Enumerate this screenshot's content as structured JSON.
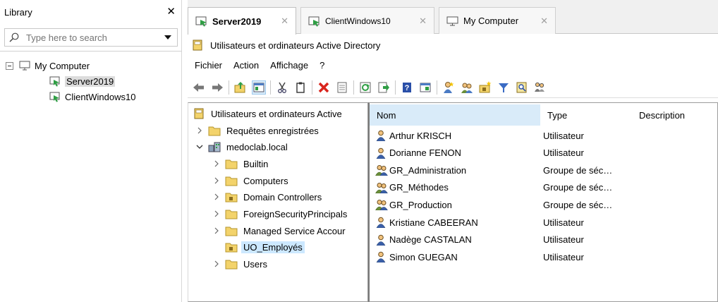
{
  "library": {
    "title": "Library",
    "close": "✕",
    "search_placeholder": "Type here to search",
    "root": "My Computer",
    "items": [
      "Server2019",
      "ClientWindows10"
    ]
  },
  "tabs": [
    {
      "label": "Server2019",
      "close": "✕"
    },
    {
      "label": "ClientWindows10",
      "close": "✕"
    },
    {
      "label": "My Computer",
      "close": "✕"
    }
  ],
  "app": {
    "title": "Utilisateurs et ordinateurs Active Directory",
    "menu": [
      "Fichier",
      "Action",
      "Affichage",
      "?"
    ]
  },
  "tree": {
    "root": "Utilisateurs et ordinateurs Active",
    "saved_queries": "Requêtes enregistrées",
    "domain": "medoclab.local",
    "children": [
      "Builtin",
      "Computers",
      "Domain Controllers",
      "ForeignSecurityPrincipals",
      "Managed Service Accour",
      "UO_Employés",
      "Users"
    ]
  },
  "list": {
    "columns": [
      "Nom",
      "Type",
      "Description"
    ],
    "rows": [
      {
        "name": "Arthur KRISCH",
        "type": "Utilisateur",
        "icon": "user-icon"
      },
      {
        "name": "Dorianne FENON",
        "type": "Utilisateur",
        "icon": "user-icon"
      },
      {
        "name": "GR_Administration",
        "type": "Groupe de séc…",
        "icon": "group-icon"
      },
      {
        "name": "GR_Méthodes",
        "type": "Groupe de séc…",
        "icon": "group-icon"
      },
      {
        "name": "GR_Production",
        "type": "Groupe de séc…",
        "icon": "group-icon"
      },
      {
        "name": "Kristiane CABEERAN",
        "type": "Utilisateur",
        "icon": "user-icon"
      },
      {
        "name": "Nadège CASTALAN",
        "type": "Utilisateur",
        "icon": "user-icon"
      },
      {
        "name": "Simon GUEGAN",
        "type": "Utilisateur",
        "icon": "user-icon"
      }
    ]
  },
  "colors": {
    "selection": "#cce8ff",
    "header_selected": "#d9ebf9",
    "folder": "#f3d36b",
    "vm_green": "#2f9e44"
  }
}
